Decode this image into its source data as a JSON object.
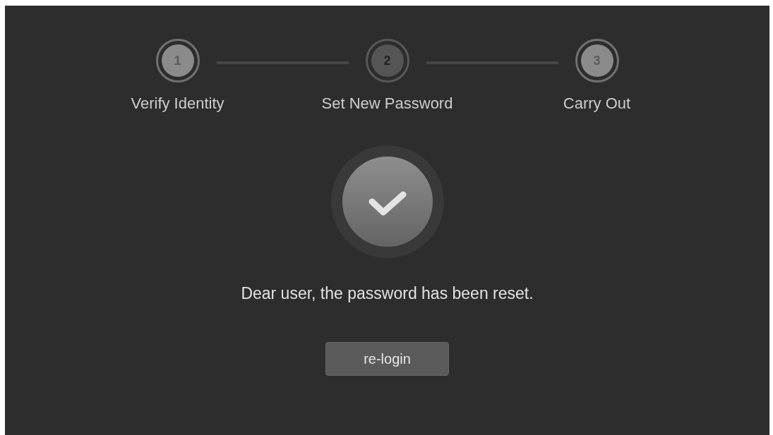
{
  "steps": [
    {
      "number": "1",
      "label": "Verify Identity",
      "active": true
    },
    {
      "number": "2",
      "label": "Set New Password",
      "active": false
    },
    {
      "number": "3",
      "label": "Carry Out",
      "active": true
    }
  ],
  "result": {
    "message": "Dear user, the password has been reset.",
    "button": "re-login"
  }
}
